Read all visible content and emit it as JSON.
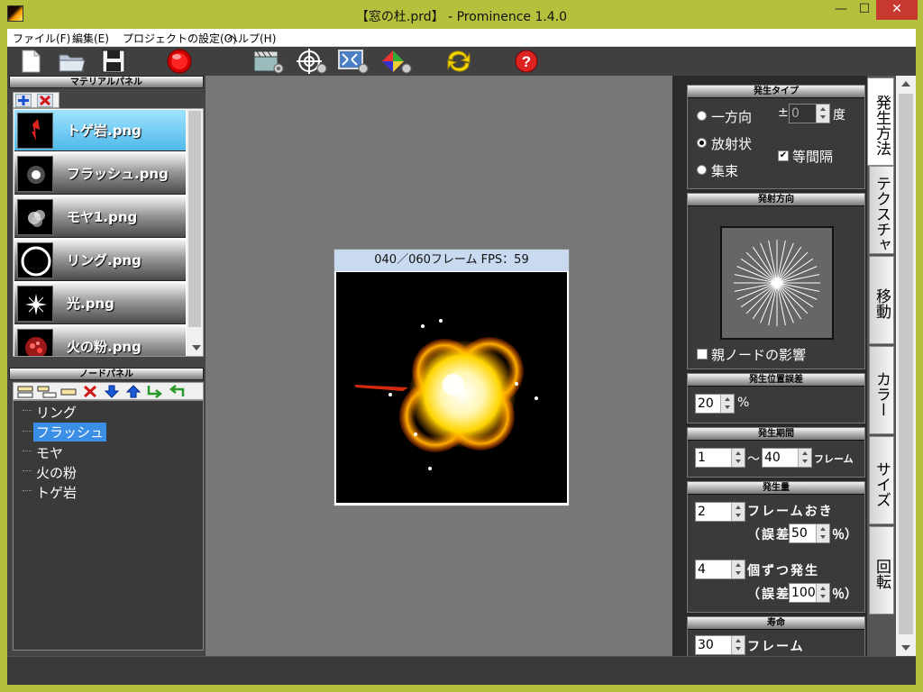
{
  "window": {
    "title": "【窓の杜.prd】 - Prominence 1.4.0",
    "min_label": "—",
    "max_label": "☐",
    "close_label": "✕"
  },
  "menu": [
    {
      "label": "ファイル(F)"
    },
    {
      "label": "編集(E)"
    },
    {
      "label": "プロジェクトの設定(O)"
    },
    {
      "label": "ヘルプ(H)"
    }
  ],
  "toolbar_icons": [
    "new-file-icon",
    "open-folder-icon",
    "save-icon",
    "record-icon",
    "movie-settings-icon",
    "target-settings-icon",
    "screen-settings-icon",
    "color-settings-icon",
    "refresh-icon",
    "help-icon"
  ],
  "material_panel": {
    "title": "マテリアルパネル",
    "items": [
      {
        "label": "トゲ岩.png",
        "thumb": "red-spike",
        "selected": true
      },
      {
        "label": "フラッシュ.png",
        "thumb": "white-flash",
        "selected": false
      },
      {
        "label": "モヤ1.png",
        "thumb": "white-fog",
        "selected": false
      },
      {
        "label": "リング.png",
        "thumb": "white-ring",
        "selected": false
      },
      {
        "label": "光.png",
        "thumb": "white-star",
        "selected": false
      },
      {
        "label": "火の粉.png",
        "thumb": "red-sparks",
        "selected": false
      }
    ]
  },
  "node_panel": {
    "title": "ノードパネル",
    "items": [
      {
        "label": "リング",
        "selected": false
      },
      {
        "label": "フラッシュ",
        "selected": true
      },
      {
        "label": "モヤ",
        "selected": false
      },
      {
        "label": "火の粉",
        "selected": false
      },
      {
        "label": "トゲ岩",
        "selected": false
      }
    ]
  },
  "preview": {
    "title": "040／060フレーム  FPS：59"
  },
  "emit_type": {
    "title": "発生タイプ",
    "option_one_way": "一方向",
    "option_radial": "放射状",
    "option_converge": "集束",
    "selected": "放射状",
    "angle_prefix": "±",
    "angle_value": "0",
    "angle_unit": "度",
    "equal_interval_label": "等間隔",
    "equal_interval_checked": true
  },
  "emit_direction": {
    "title": "発射方向",
    "ray_count": 32,
    "parent_node_label": "親ノードの影響",
    "parent_node_checked": false
  },
  "position_error": {
    "title": "発生位置誤差",
    "value": "20",
    "unit": "%"
  },
  "emit_period": {
    "title": "発生期間",
    "from": "1",
    "separator": "〜",
    "to": "40",
    "unit": "フレーム"
  },
  "emit_amount": {
    "title": "発生量",
    "every_value": "2",
    "every_label": "フレームおき",
    "error1_prefix": "（誤差",
    "error1_value": "50",
    "error1_suffix": "％）",
    "count_value": "4",
    "count_label": "個ずつ発生",
    "error2_prefix": "（誤差",
    "error2_value": "100",
    "error2_suffix": "％）"
  },
  "lifetime": {
    "title": "寿命",
    "value": "30",
    "unit": "フレーム"
  },
  "side_tabs": [
    {
      "label": "発生方法",
      "selected": true
    },
    {
      "label": "テクスチャ",
      "selected": false
    },
    {
      "label": "移動",
      "selected": false
    },
    {
      "label": "カラー",
      "selected": false
    },
    {
      "label": "サイズ",
      "selected": false
    },
    {
      "label": "回転",
      "selected": false
    }
  ],
  "colors": {
    "window_frame": "#b5c13d",
    "selection_blue": "#3b8ee6",
    "material_selected": "#4fb9ea",
    "close_red": "#c7382e"
  }
}
